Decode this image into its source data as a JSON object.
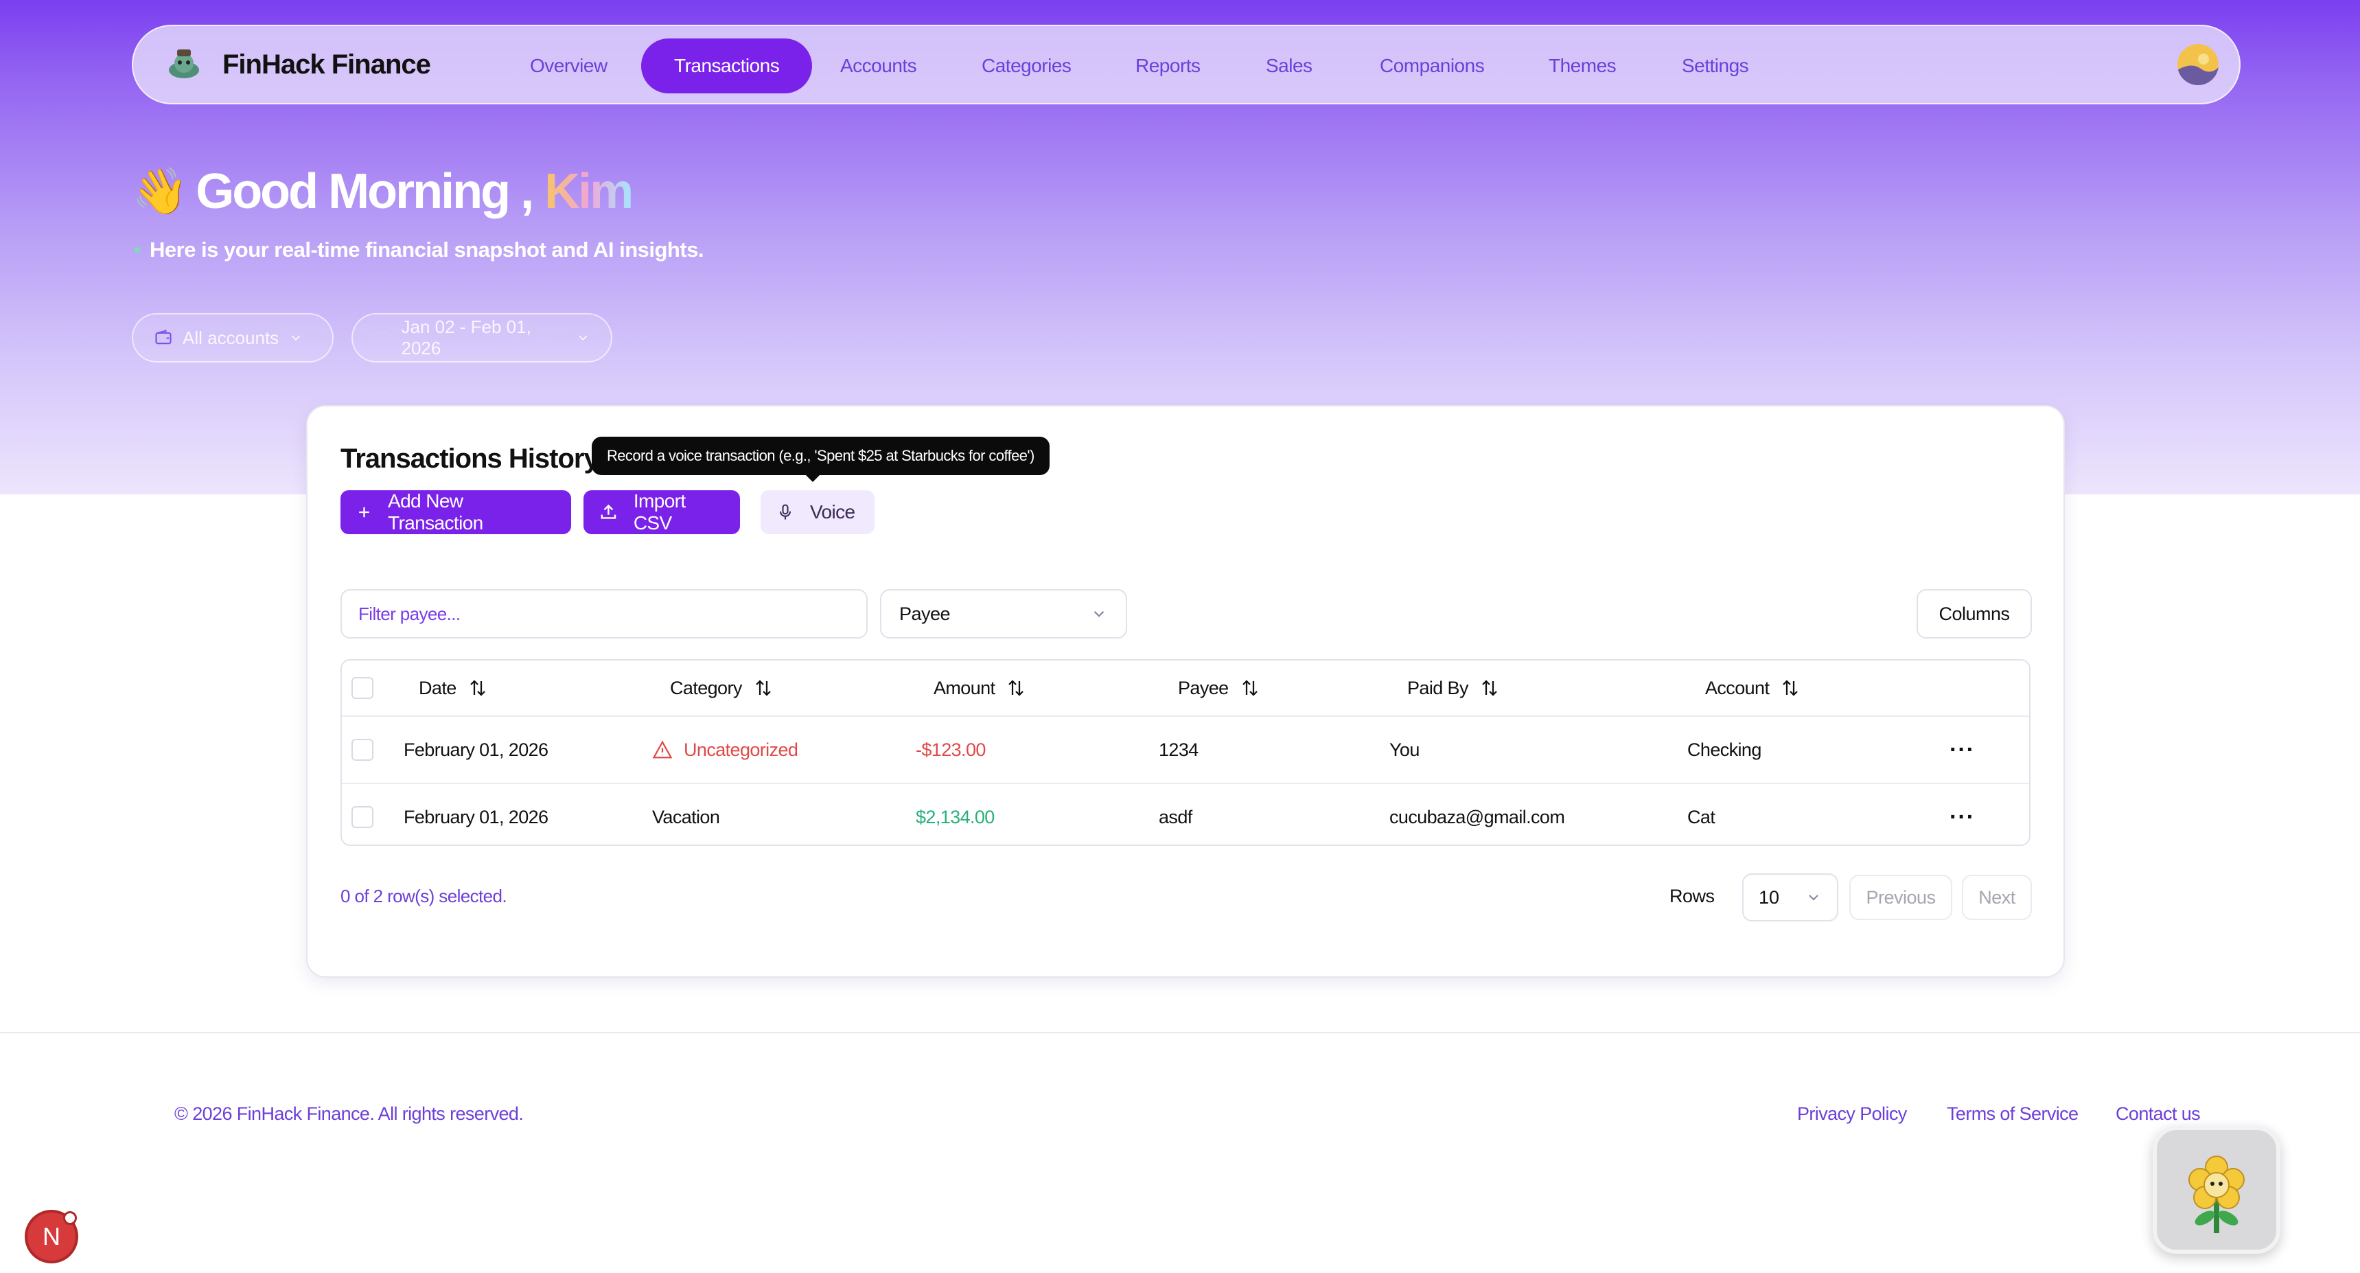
{
  "app": {
    "brand": "FinHack Finance"
  },
  "nav": {
    "items": [
      {
        "label": "Overview"
      },
      {
        "label": "Transactions",
        "active": true
      },
      {
        "label": "Accounts"
      },
      {
        "label": "Categories"
      },
      {
        "label": "Reports"
      },
      {
        "label": "Sales"
      },
      {
        "label": "Companions"
      },
      {
        "label": "Themes"
      },
      {
        "label": "Settings"
      }
    ]
  },
  "hero": {
    "greeting": "Good Morning ,",
    "name": "Kim",
    "wave_emoji": "👋",
    "subtitle": "Here is your real-time financial snapshot and AI insights.",
    "accounts_filter": "All accounts",
    "date_range": "Jan 02 - Feb 01, 2026"
  },
  "card": {
    "title": "Transactions History",
    "tooltip": "Record a voice transaction (e.g., 'Spent $25 at Starbucks for coffee')",
    "add_button": "Add New Transaction",
    "import_button": "Import CSV",
    "voice_button": "Voice",
    "filter_placeholder": "Filter payee...",
    "filter_column": "Payee",
    "columns_button": "Columns"
  },
  "table": {
    "headers": [
      "Date",
      "Category",
      "Amount",
      "Payee",
      "Paid By",
      "Account"
    ],
    "rows": [
      {
        "date": "February 01, 2026",
        "category": "Uncategorized",
        "amount": "-$123.00",
        "payee": "1234",
        "paid_by": "You",
        "account": "Checking"
      },
      {
        "date": "February 01, 2026",
        "category": "Vacation",
        "amount": "$2,134.00",
        "payee": "asdf",
        "paid_by": "cucubaza@gmail.com",
        "account": "Cat"
      }
    ],
    "selected_note": "0 of 2 row(s) selected.",
    "rows_label": "Rows",
    "rows_value": "10",
    "previous": "Previous",
    "next": "Next"
  },
  "footer": {
    "copyright": "© 2026 FinHack Finance. All rights reserved.",
    "links": [
      "Privacy Policy",
      "Terms of Service",
      "Contact us"
    ]
  },
  "badge": {
    "letter": "N"
  },
  "colors": {
    "accent": "#7a22ea",
    "link": "#6c3fd9",
    "negative": "#e04848",
    "positive": "#27b07a"
  }
}
